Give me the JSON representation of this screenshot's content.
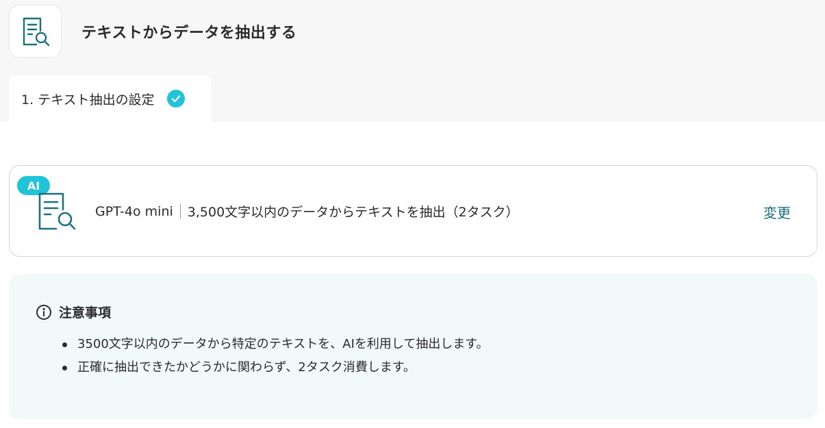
{
  "header": {
    "title": "テキストからデータを抽出する",
    "icon": "document-search-icon"
  },
  "tabs": [
    {
      "label": "1. テキスト抽出の設定",
      "status": "complete",
      "icon": "check-circle-icon"
    }
  ],
  "model_card": {
    "badge": "AI",
    "icon": "document-search-icon",
    "model_name": "GPT-4o mini",
    "description": "3,500文字以内のデータからテキストを抽出（2タスク）",
    "change_label": "変更"
  },
  "notice": {
    "icon": "info-circle-icon",
    "title": "注意事項",
    "items": [
      "3500文字以内のデータから特定のテキストを、AIを利用して抽出します。",
      "正確に抽出できたかどうかに関わらず、2タスク消費します。"
    ]
  },
  "colors": {
    "accent": "#1fc4d8",
    "icon_teal": "#19707f",
    "notice_bg": "#f1f9f9",
    "top_bg": "#f7f7f7"
  }
}
